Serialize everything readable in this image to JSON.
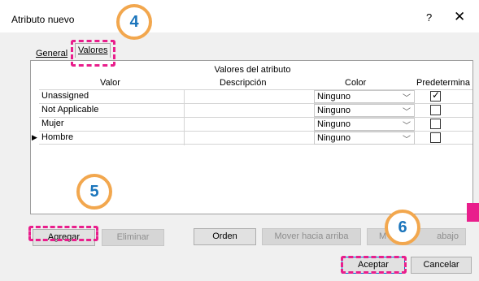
{
  "window": {
    "title": "Atributo nuevo",
    "help_label": "?",
    "close_label": "✕"
  },
  "tabs": [
    {
      "label": "General"
    },
    {
      "label": "Valores"
    }
  ],
  "grid": {
    "group_header": "Valores del atributo",
    "columns": [
      "Valor",
      "Descripción",
      "Color",
      "Predetermina"
    ],
    "rows": [
      {
        "valor": "Unassigned",
        "descripcion": "",
        "color": "Ninguno",
        "predeterminado": true
      },
      {
        "valor": "Not Applicable",
        "descripcion": "",
        "color": "Ninguno",
        "predeterminado": false
      },
      {
        "valor": "Mujer",
        "descripcion": "",
        "color": "Ninguno",
        "predeterminado": false
      },
      {
        "valor": "Hombre",
        "descripcion": "",
        "color": "Ninguno",
        "predeterminado": false
      }
    ]
  },
  "buttons": {
    "agregar": "Agregar",
    "eliminar": "Eliminar",
    "orden": "Orden",
    "mover_arriba": "Mover hacia arriba",
    "mover_abajo_start": "M",
    "mover_abajo_end": "abajo",
    "aceptar": "Aceptar",
    "cancelar": "Cancelar"
  },
  "steps": {
    "s4": "4",
    "s5": "5",
    "s6": "6"
  },
  "colors": {
    "highlight": "#e91e8c",
    "badge_border": "#f2a74e",
    "badge_text": "#1b75bc",
    "primary_border": "#0078d7"
  }
}
